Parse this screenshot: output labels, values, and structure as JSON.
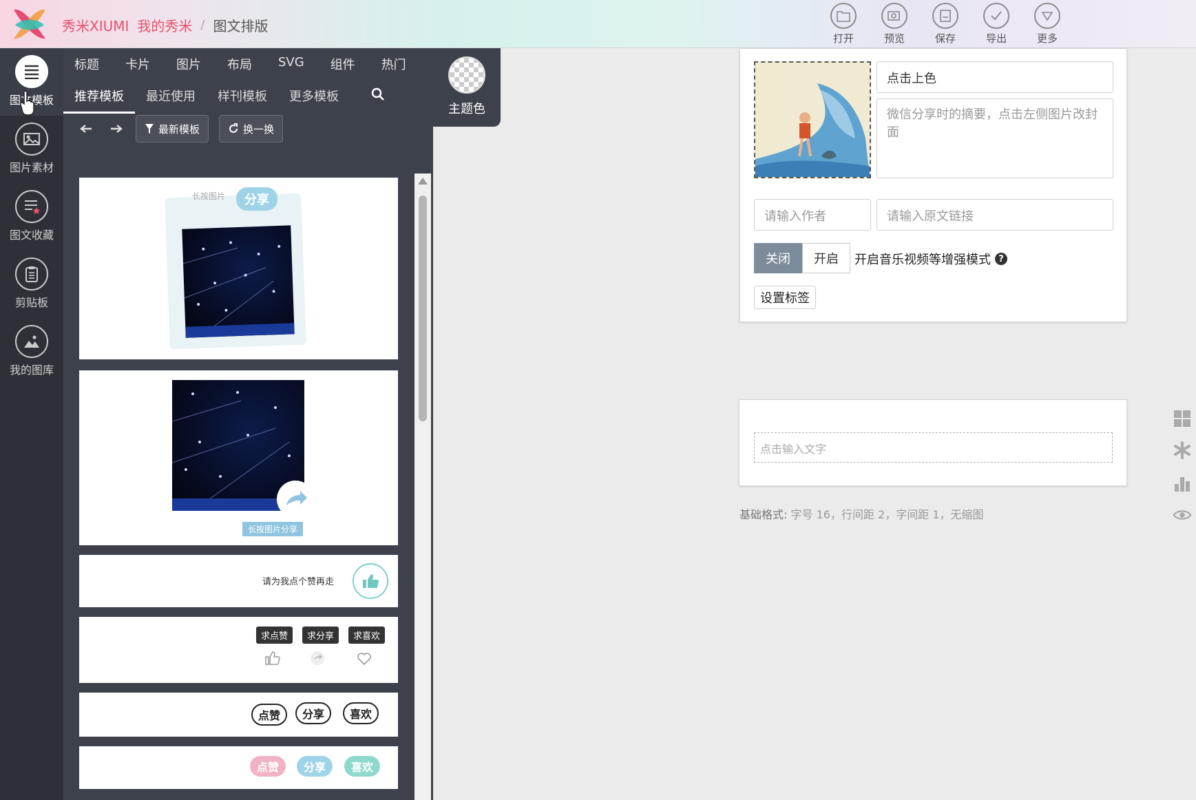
{
  "colors": {
    "brand_pink": "#e8516c",
    "panel_dark": "#3c414b",
    "rail_dark": "#2d3037",
    "toggle_on": "#7d8c9b"
  },
  "header": {
    "breadcrumb": {
      "site": "秀米XIUMI",
      "mine": "我的秀米",
      "sep": "/",
      "current": "图文排版"
    },
    "toolbar": [
      {
        "icon": "folder-icon",
        "label": "打开"
      },
      {
        "icon": "preview-icon",
        "label": "预览"
      },
      {
        "icon": "save-icon",
        "label": "保存"
      },
      {
        "icon": "check-icon",
        "label": "导出"
      },
      {
        "icon": "more-icon",
        "label": "更多"
      }
    ]
  },
  "rail": [
    {
      "icon": "list-icon",
      "label": "图文模板"
    },
    {
      "icon": "image-icon",
      "label": "图片素材"
    },
    {
      "icon": "favorites-icon",
      "label": "图文收藏"
    },
    {
      "icon": "clipboard-icon",
      "label": "剪贴板"
    },
    {
      "icon": "gallery-icon",
      "label": "我的图库"
    }
  ],
  "panel": {
    "categories": [
      "标题",
      "卡片",
      "图片",
      "布局",
      "SVG",
      "组件",
      "热门"
    ],
    "tabs": [
      "推荐模板",
      "最近使用",
      "样刊模板",
      "更多模板"
    ],
    "theme_label": "主题色",
    "filter_label": "最新模板",
    "refresh_label": "换一换"
  },
  "templates": {
    "t1": {
      "caption": "长按图片",
      "tag": "分享"
    },
    "t2": {
      "caption": "长按图片分享"
    },
    "t3": {
      "text": "请为我点个赞再走"
    },
    "t4": {
      "bubbles": [
        "求点赞",
        "求分享",
        "求喜欢"
      ]
    },
    "t5": {
      "pills": [
        "点赞",
        "分享",
        "喜欢"
      ]
    },
    "t6": {
      "pills": [
        "点赞",
        "分享",
        "喜欢"
      ]
    }
  },
  "editor": {
    "title_value": "点击上色",
    "summary_placeholder": "微信分享时的摘要，点击左侧图片改封面",
    "author_placeholder": "请输入作者",
    "link_placeholder": "请输入原文链接",
    "toggle_off": "关闭",
    "toggle_on": "开启",
    "toggle_label": "开启音乐视频等增强模式",
    "tag_button": "设置标签",
    "text_placeholder": "点击输入文字",
    "base_format_label": "基础格式:",
    "base_format_value": "字号 16，行间距 2，字间距 1，无缩图"
  },
  "side_tools": [
    "grid-icon",
    "asterisk-icon",
    "bar-chart-icon",
    "eye-icon"
  ]
}
